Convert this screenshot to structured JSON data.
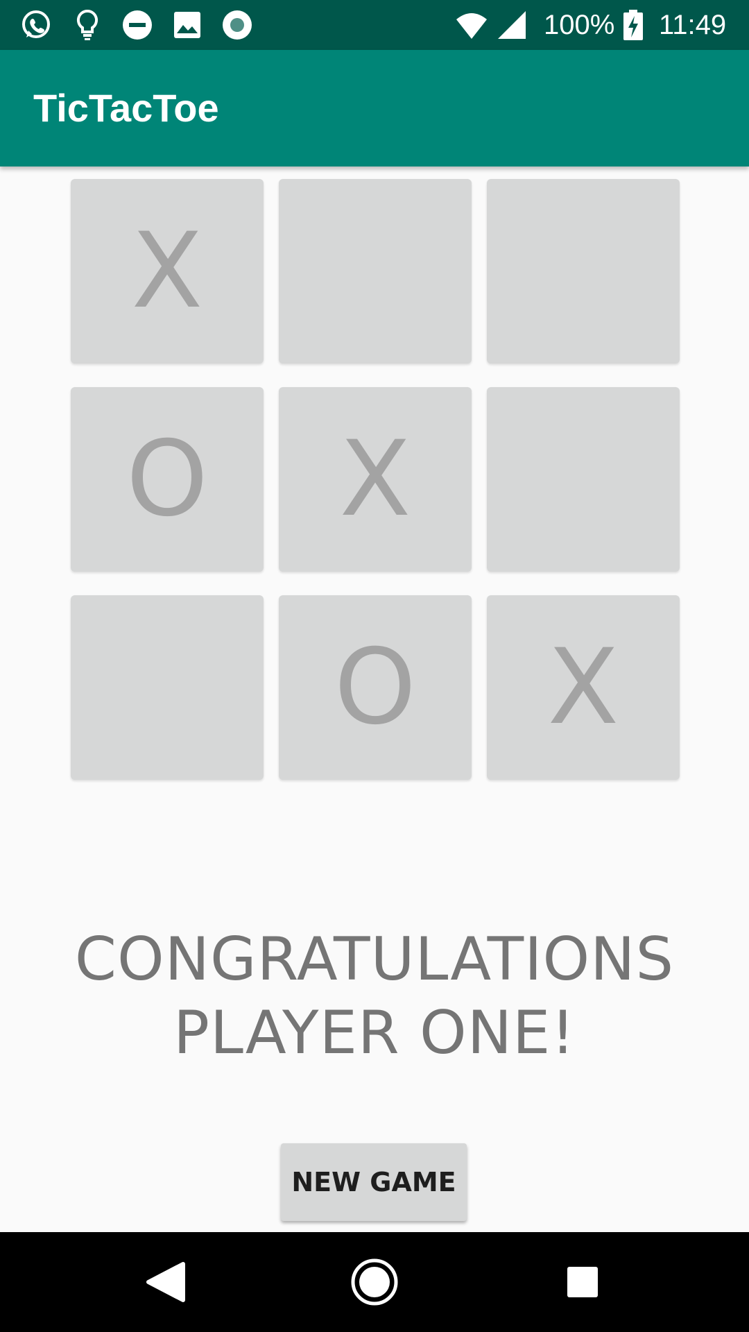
{
  "status_bar": {
    "battery_percent": "100%",
    "time": "11:49",
    "icons": [
      "whatsapp-icon",
      "lightbulb-icon",
      "do-not-disturb-icon",
      "image-icon",
      "record-icon",
      "wifi-icon",
      "cell-signal-icon",
      "battery-charging-icon"
    ]
  },
  "app_bar": {
    "title": "TicTacToe"
  },
  "board": {
    "cells": [
      "X",
      "",
      "",
      "O",
      "X",
      "",
      "",
      "O",
      "X"
    ]
  },
  "message": {
    "line1": "CONGRATULATIONS",
    "line2": "PLAYER ONE!"
  },
  "controls": {
    "new_game_label": "NEW GAME"
  },
  "nav_bar": {
    "icons": [
      "back-icon",
      "home-icon",
      "recents-icon"
    ]
  },
  "colors": {
    "status_bar": "#00574b",
    "app_bar": "#008577",
    "background": "#fafafa",
    "cell": "#d6d7d7",
    "mark": "#a3a3a3",
    "message": "#757575"
  }
}
